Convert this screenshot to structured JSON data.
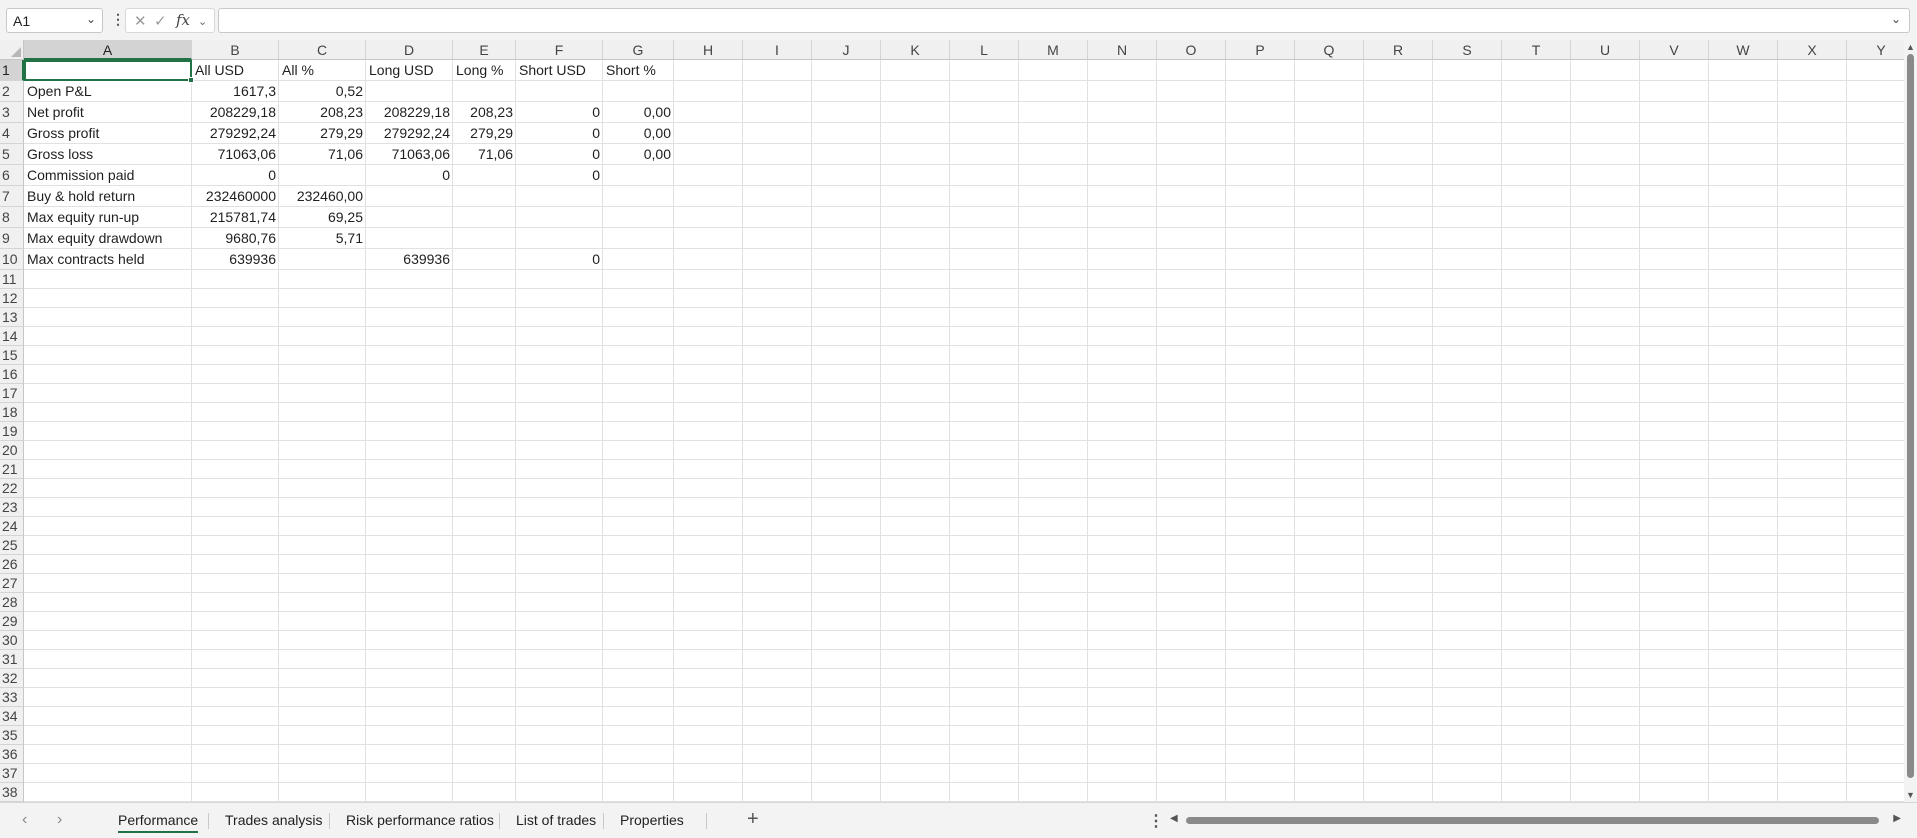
{
  "formula_bar": {
    "name_box": "A1",
    "formula": "",
    "fx_label": "fx"
  },
  "columns": [
    "A",
    "B",
    "C",
    "D",
    "E",
    "F",
    "G",
    "H",
    "I",
    "J",
    "K",
    "L",
    "M",
    "N",
    "O",
    "P",
    "Q",
    "R",
    "S",
    "T",
    "U",
    "V",
    "W",
    "X",
    "Y"
  ],
  "row_numbers": [
    "1",
    "2",
    "3",
    "4",
    "5",
    "6",
    "7",
    "8",
    "9",
    "10",
    "11",
    "12",
    "13",
    "14",
    "15",
    "16",
    "17",
    "18",
    "19",
    "20",
    "21",
    "22",
    "23",
    "24",
    "25",
    "26",
    "27",
    "28",
    "29",
    "30",
    "31",
    "32",
    "33",
    "34",
    "35",
    "36",
    "37",
    "38"
  ],
  "header_row": [
    "",
    "All USD",
    "All %",
    "Long USD",
    "Long %",
    "Short USD",
    "Short %"
  ],
  "rows": [
    [
      "Open P&L",
      "1617,3",
      "0,52",
      "",
      "",
      "",
      ""
    ],
    [
      "Net profit",
      "208229,18",
      "208,23",
      "208229,18",
      "208,23",
      "0",
      "0,00"
    ],
    [
      "Gross profit",
      "279292,24",
      "279,29",
      "279292,24",
      "279,29",
      "0",
      "0,00"
    ],
    [
      "Gross loss",
      "71063,06",
      "71,06",
      "71063,06",
      "71,06",
      "0",
      "0,00"
    ],
    [
      "Commission paid",
      "0",
      "",
      "0",
      "",
      "0",
      ""
    ],
    [
      "Buy & hold return",
      "232460000",
      "232460,00",
      "",
      "",
      "",
      ""
    ],
    [
      "Max equity run-up",
      "215781,74",
      "69,25",
      "",
      "",
      "",
      ""
    ],
    [
      "Max equity drawdown",
      "9680,76",
      "5,71",
      "",
      "",
      "",
      ""
    ],
    [
      "Max contracts held",
      "639936",
      "",
      "639936",
      "",
      "0",
      ""
    ]
  ],
  "sheet_tabs": [
    "Performance",
    "Trades analysis",
    "Risk performance ratios",
    "List of trades",
    "Properties"
  ],
  "active_tab": "Performance",
  "colors": {
    "accent": "#217346",
    "header_bg": "#f0f0f0",
    "grid_line": "#e1e1e1"
  },
  "icons": [
    "chevron-down-icon",
    "cancel-icon",
    "enter-icon",
    "fx-icon",
    "add-sheet-icon",
    "scroll-left-icon",
    "scroll-right-icon"
  ]
}
